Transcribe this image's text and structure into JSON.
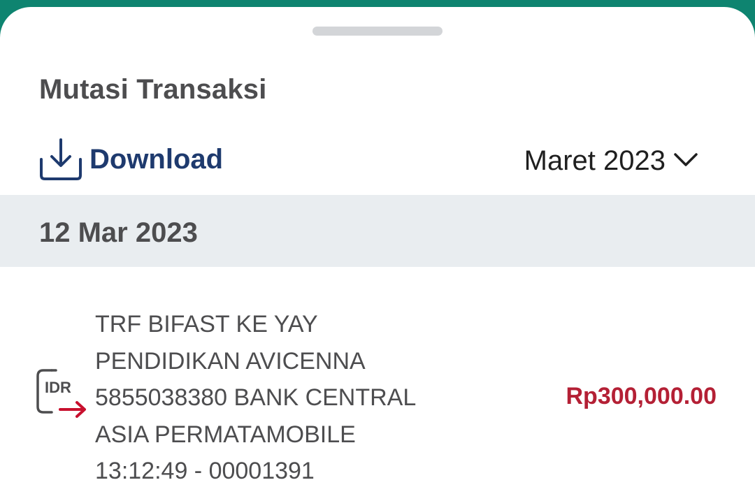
{
  "sheet": {
    "title": "Mutasi Transaksi"
  },
  "toolbar": {
    "download_label": "Download",
    "download_icon": "download-icon",
    "month_selected": "Maret 2023",
    "month_icon": "chevron-down-icon"
  },
  "transactions": {
    "date": "12 Mar 2023",
    "items": [
      {
        "icon": "idr-transfer-out-icon",
        "icon_text": "IDR",
        "lines": [
          "TRF BIFAST KE YAY",
          "PENDIDIKAN AVICENNA",
          "5855038380 BANK CENTRAL",
          "ASIA PERMATAMOBILE",
          "13:12:49 - 00001391"
        ],
        "amount": "Rp300,000.00",
        "amount_color": "#b42035"
      }
    ]
  },
  "colors": {
    "header_bar": "#0e8470",
    "primary_text": "#4d4d4f",
    "download_blue": "#1e3a6e",
    "date_header_bg": "#e9edf0",
    "debit_red": "#b42035"
  }
}
